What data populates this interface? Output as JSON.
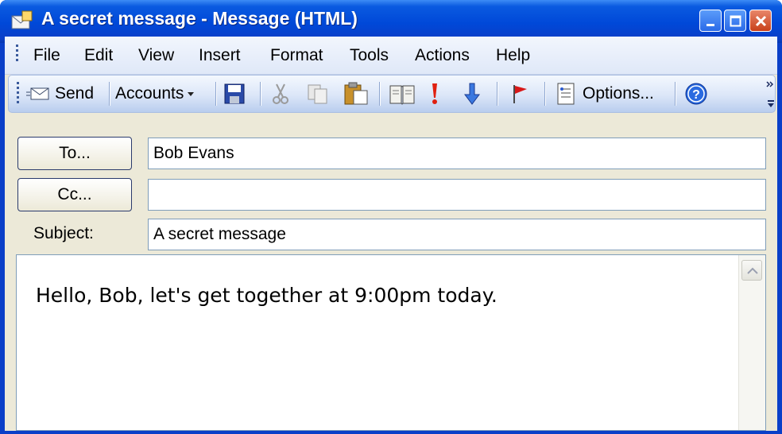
{
  "window": {
    "title": "A secret message - Message (HTML)"
  },
  "menu": {
    "items": [
      {
        "label": "File"
      },
      {
        "label": "Edit"
      },
      {
        "label": "View"
      },
      {
        "label": "Insert"
      },
      {
        "label": "Format"
      },
      {
        "label": "Tools"
      },
      {
        "label": "Actions"
      },
      {
        "label": "Help"
      }
    ]
  },
  "toolbar": {
    "send_label": "Send",
    "accounts_label": "Accounts",
    "options_label": "Options...",
    "icons": [
      "send-icon",
      "save-icon",
      "cut-icon",
      "copy-icon",
      "paste-icon",
      "address-book-icon",
      "importance-high-icon",
      "importance-low-icon",
      "flag-icon",
      "options-icon",
      "help-icon"
    ]
  },
  "header": {
    "to_label": "To...",
    "to_value": "Bob Evans",
    "cc_label": "Cc...",
    "cc_value": "",
    "subject_label": "Subject:",
    "subject_value": "A secret message"
  },
  "body": {
    "text": "Hello, Bob, let's get together at 9:00pm today."
  },
  "colors": {
    "titlebar": "#0a3fc8",
    "client_bg": "#ece9d8",
    "close_button": "#c8401a"
  }
}
